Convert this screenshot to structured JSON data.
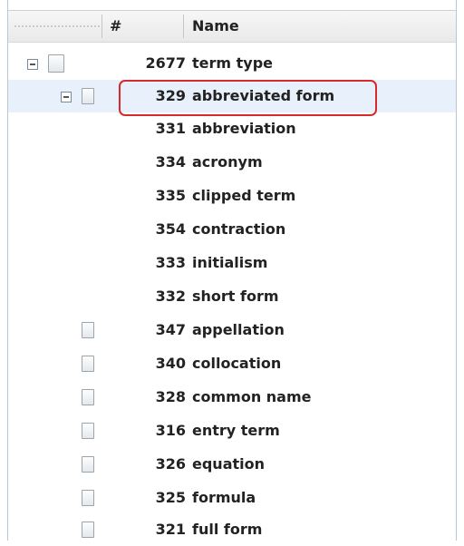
{
  "header": {
    "col_num": "#",
    "col_name": "Name"
  },
  "rows": [
    {
      "num": "2677",
      "name": "term type",
      "expanded": true,
      "icon": "document-icon",
      "selected": false
    },
    {
      "num": "329",
      "name": "abbreviated form",
      "expanded": true,
      "icon": "document-icon",
      "selected": true,
      "highlighted": true
    },
    {
      "num": "331",
      "name": "abbreviation"
    },
    {
      "num": "334",
      "name": "acronym"
    },
    {
      "num": "335",
      "name": "clipped term"
    },
    {
      "num": "354",
      "name": "contraction"
    },
    {
      "num": "333",
      "name": "initialism"
    },
    {
      "num": "332",
      "name": "short form"
    },
    {
      "num": "347",
      "name": "appellation",
      "icon": "document-icon"
    },
    {
      "num": "340",
      "name": "collocation",
      "icon": "document-icon"
    },
    {
      "num": "328",
      "name": "common name",
      "icon": "document-icon"
    },
    {
      "num": "316",
      "name": "entry term",
      "icon": "document-icon"
    },
    {
      "num": "326",
      "name": "equation",
      "icon": "document-icon"
    },
    {
      "num": "325",
      "name": "formula",
      "icon": "document-icon"
    },
    {
      "num": "321",
      "name": "full form",
      "icon": "document-icon"
    }
  ],
  "colors": {
    "selected_row": "#e7f0fb",
    "highlight_border": "#d62b2b",
    "text": "#222222"
  }
}
